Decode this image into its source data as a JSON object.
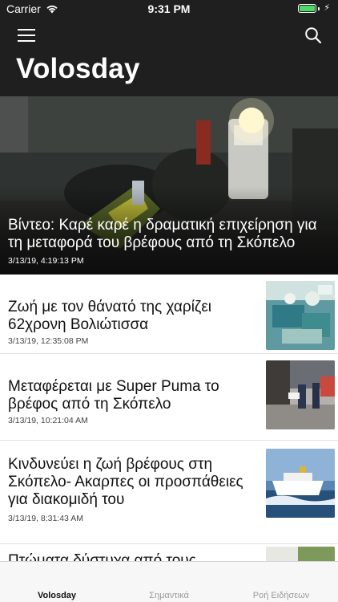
{
  "status_bar": {
    "carrier": "Carrier",
    "time": "9:31 PM",
    "battery_fill": 1.0,
    "battery_color": "#4cd964"
  },
  "header": {
    "title": "Volosday",
    "menu_icon": "hamburger-icon",
    "search_icon": "search-icon",
    "background": "#1f1f1f"
  },
  "hero": {
    "title": "Βίντεο: Καρέ καρέ η δραματική επιχείρηση για τη μεταφορά του βρέφους από τη Σκόπελο",
    "date": "3/13/19, 4:19:13 PM"
  },
  "articles": [
    {
      "title": "Ζωή με τον θάνατό της χαρίζει 62χρονη Βολιώτισσα",
      "date": "3/13/19, 12:35:08 PM",
      "thumb": "surgery-photo"
    },
    {
      "title": "Μεταφέρεται με Super Puma το βρέφος από τη Σκόπελο",
      "date": "3/13/19, 10:21:04 AM",
      "thumb": "helicopter-transfer-photo"
    },
    {
      "title": "Κινδυνεύει η ζωή βρέφους στη Σκόπελο- Ακαρπες οι προσπάθειες για διακομιδή του",
      "date": "3/13/19, 8:31:43 AM",
      "thumb": "ferry-storm-photo"
    },
    {
      "title": "Πτώματα δύστυχα από τους",
      "date": "",
      "thumb": "partial-photo"
    }
  ],
  "tabbar": {
    "tabs": [
      {
        "label": "Volosday",
        "active": true
      },
      {
        "label": "Σημαντικά",
        "active": false
      },
      {
        "label": "Ροή Ειδήσεων",
        "active": false
      }
    ]
  }
}
